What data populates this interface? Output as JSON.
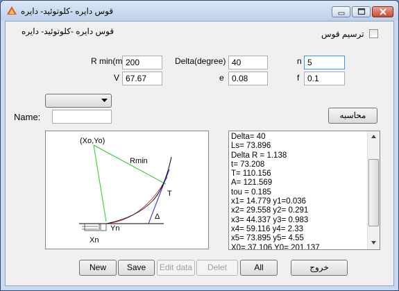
{
  "window": {
    "title": "قوس دایره -کلوتوئید- دایره"
  },
  "subtitle": "قوس دایره -کلوتوئید- دایره",
  "draw_checkbox": {
    "label": "ترسیم قوس",
    "checked": false
  },
  "params": {
    "rmin": {
      "label": "R min(m)",
      "value": "200"
    },
    "delta": {
      "label": "Delta(degree)",
      "value": "40"
    },
    "n": {
      "label": "n",
      "value": "5"
    },
    "v": {
      "label": "V",
      "value": "67.67"
    },
    "e": {
      "label": "e",
      "value": "0.08"
    },
    "f": {
      "label": "f",
      "value": "0.1"
    }
  },
  "name": {
    "label": "Name:",
    "value": ""
  },
  "dropdown": {
    "selected": ""
  },
  "calc_button": "محاسبه",
  "diagram": {
    "label_xoyo": "(Xo,Yo)",
    "label_rmin": "Rmin",
    "label_t": "T",
    "label_delta": "Δ",
    "label_yn": "Yn",
    "label_xn": "Xn"
  },
  "results": [
    "Delta=  40",
    "Ls=  73.896",
    "Delta R =  1.138",
    "t=  73.208",
    "T=  110.156",
    "A=  121.569",
    "tou =  0.185",
    "x1=  14.779     y1=0.036",
    "x2=  29.558    y2=  0.291",
    "x3=  44.337    y3=  0.983",
    "x4=  59.116    y4=  2.33",
    "x5=  73.895    y5=  4.55",
    "X0=  37.106     Y0=  201.137"
  ],
  "buttons": {
    "new": "New",
    "save": "Save",
    "edit": "Edit data",
    "delete": "Delet",
    "all": "All",
    "exit": "خروج"
  }
}
